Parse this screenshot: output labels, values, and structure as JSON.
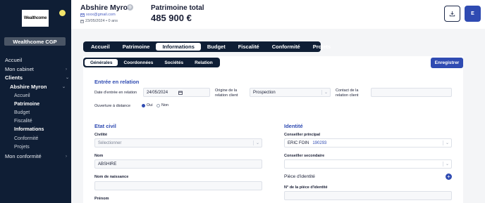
{
  "sidebar": {
    "logo_text": "Wealthcome",
    "brand_button": "Wealthcome CGP",
    "items": [
      {
        "label": "Accueil"
      },
      {
        "label": "Mon cabinet"
      },
      {
        "label": "Clients"
      },
      {
        "label": "Abshire Myron"
      },
      {
        "label": "Mon conformité"
      }
    ],
    "subitems": [
      {
        "label": "Accueil"
      },
      {
        "label": "Patrimoine"
      },
      {
        "label": "Budget"
      },
      {
        "label": "Fiscalité"
      },
      {
        "label": "Informations"
      },
      {
        "label": "Conformité"
      },
      {
        "label": "Projets"
      }
    ]
  },
  "header": {
    "client_name": "Abshire Myron",
    "email": "xxxx@gmail.com",
    "date_age": "23/05/2024 • 0 ans",
    "patrimoine_label": "Patrimoine total",
    "patrimoine_value": "485 900 €",
    "user_initial": "E"
  },
  "main_tabs": [
    "Accueil",
    "Patrimoine",
    "Informations",
    "Budget",
    "Fiscalité",
    "Conformité",
    "Projets"
  ],
  "sub_tabs": [
    "Générales",
    "Coordonnées",
    "Sociétés",
    "Relation"
  ],
  "save_label": "Enregistrer",
  "relation": {
    "title": "Entrée en relation",
    "date_label": "Date d'entrée en relation",
    "date_value": "24/05/2024",
    "origine_label_1": "Origine de la",
    "origine_label_2": "relation client",
    "origine_value": "Prospection",
    "contact_label_1": "Contact de la",
    "contact_label_2": "relation client",
    "ouverture_label": "Ouverture à distance",
    "oui": "Oui",
    "non": "Non"
  },
  "etat_civil": {
    "title": "Etat civil",
    "civilite_label": "Civilité",
    "civilite_placeholder": "Sélectionner",
    "nom_label": "Nom",
    "nom_value": "ABSHIRE",
    "nom_naissance_label": "Nom de naissance",
    "prenom_label": "Prénom"
  },
  "identite": {
    "title": "Identité",
    "conseiller_principal_label": "Conseiller principal",
    "conseiller_principal_value": "ERIC FOIN",
    "conseiller_principal_code": "190293",
    "conseiller_secondaire_label": "Conseiller secondaire",
    "piece_label": "Pièce d'identité",
    "numero_label": "N° de la pièce d'identité"
  },
  "colors": {
    "sidebar_bg": "#0f1e35",
    "accent": "#2f4bb2",
    "section_title": "#2f4bb2"
  }
}
